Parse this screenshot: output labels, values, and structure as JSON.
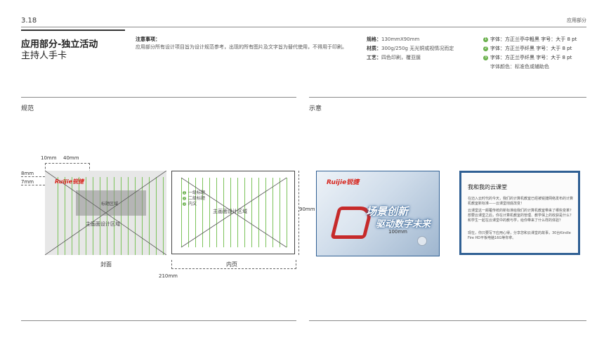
{
  "header": {
    "page_number": "3.18",
    "section": "应用部分",
    "title_line1": "应用部分-独立活动",
    "title_line2": "主持人手卡"
  },
  "notes": {
    "heading": "注意事项：",
    "body": "应用部分所有设计项目旨为设计规范参考，出现的所有图片及文字旨为替代使用，不得用于印刷。"
  },
  "specs": {
    "size_label": "规格：",
    "size_value": "130mmX90mm",
    "material_label": "材质：",
    "material_value": "300g/250g 无光铜或视情况而定",
    "process_label": "工艺：",
    "process_value": "四色印刷，覆亚膜"
  },
  "fonts": {
    "items": [
      {
        "num": "1",
        "text": "字体：方正兰亭中粗黑 字号：大于 8 pt"
      },
      {
        "num": "2",
        "text": "字体：方正兰亭纤黑 字号：大于 8 pt"
      },
      {
        "num": "3",
        "text": "字体：方正兰亭纤黑 字号：大于 8 pt"
      }
    ],
    "color": "字体颜色：标准色或辅助色"
  },
  "labels": {
    "spec_section": "规范",
    "demo_section": "示意",
    "cover": "封面",
    "inner": "内页",
    "dim_10mm": "10mm",
    "dim_40mm": "40mm",
    "dim_8mm": "8mm",
    "dim_7mm": "7mm",
    "dim_90mm": "90mm",
    "dim_210mm": "210mm",
    "dim_100mm": "100mm",
    "title_area": "标题区域",
    "main_area": "主画面设计区域",
    "inner_main_area": "主画面设计区域",
    "inner_item1": "一级标题",
    "inner_item2": "二级标题",
    "inner_item3": "内文"
  },
  "brand": {
    "logo_text": "Ruijie锐捷",
    "slogan_line1": "场景创新",
    "slogan_line2": "驱动数字未来"
  },
  "sample_inner": {
    "title": "我和我的云课堂",
    "p1": "在迈入云时代的今天，我们的计算机教室已经被锐捷网络发布的计算机教室新标准——云课堂彻底改变！",
    "p2": "云课堂这一颠覆传统的新标准给我们的计算机教室带来了哪些变革？想要云课堂之后，你在计算机教室的管理、教学保上的收获是什么？和学生一起在云课堂中的教与学，给你带来了什么样的体验？",
    "p3": "现在，你只要写下应用心得，分享您和云课堂的故事，30台Kindle Fire HD平板电脑16G等你拿。"
  },
  "colors": {
    "accent_green": "#7cc35a",
    "brand_red": "#d7261e",
    "card_blue": "#2f5f93"
  }
}
